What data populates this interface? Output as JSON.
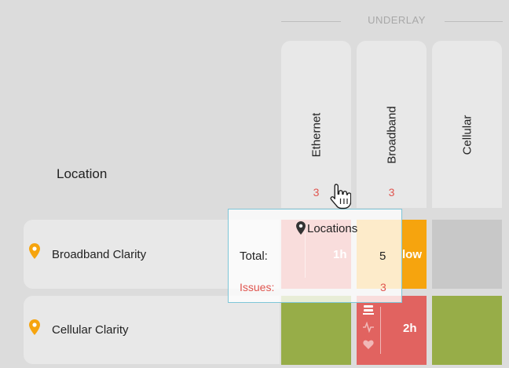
{
  "underlay": {
    "label": "UNDERLAY"
  },
  "columns": [
    {
      "name": "Ethernet",
      "count": "3"
    },
    {
      "name": "Broadband",
      "count": "3"
    },
    {
      "name": "Cellular",
      "count": ""
    }
  ],
  "location_header": "Location",
  "rows": [
    {
      "name": "Broadband Clarity",
      "cells": [
        {
          "status": "red",
          "duration": "1h"
        },
        {
          "status": "yellow",
          "text": "low"
        },
        {
          "status": "grey"
        }
      ]
    },
    {
      "name": "Cellular Clarity",
      "cells": [
        {
          "status": "green"
        },
        {
          "status": "red",
          "duration": "2h"
        },
        {
          "status": "green"
        }
      ]
    }
  ],
  "tooltip": {
    "title": "Locations",
    "total_label": "Total:",
    "total_value": "5",
    "issues_label": "Issues:",
    "issues_value": "3"
  },
  "colors": {
    "red": "#e16360",
    "yellow": "#f6a40e",
    "green": "#97ad48",
    "grey": "#c8c8c8",
    "pin": "#f6a40e",
    "issue_text": "#e0554f",
    "tooltip_border": "#7ec6d8"
  },
  "icons": [
    "map-pin-icon",
    "hand-pointer-cursor-icon",
    "server-stack-icon",
    "pulse-icon",
    "heart-icon"
  ]
}
